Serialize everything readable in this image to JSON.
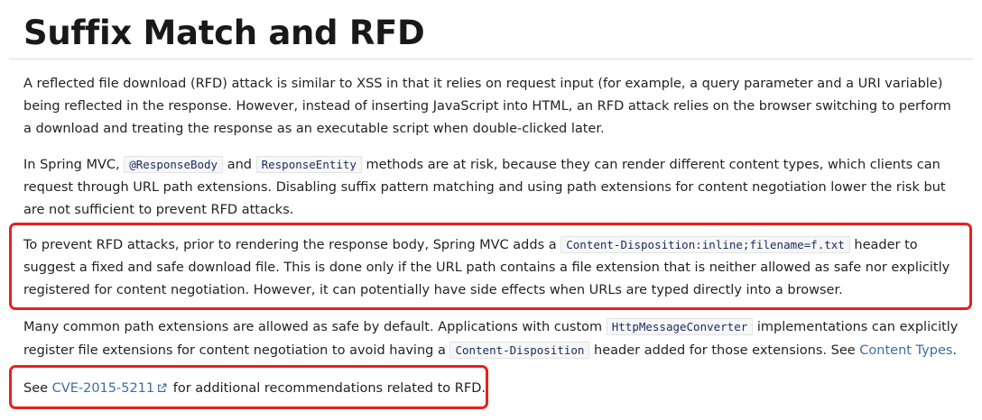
{
  "title": "Suffix Match and RFD",
  "p1": {
    "text": "A reflected file download (RFD) attack is similar to XSS in that it relies on request input (for example, a query parameter and a URI variable) being reflected in the response. However, instead of inserting JavaScript into HTML, an RFD attack relies on the browser switching to perform a download and treating the response as an executable script when double-clicked later."
  },
  "p2": {
    "t1": "In Spring MVC, ",
    "c1": "@ResponseBody",
    "t2": " and ",
    "c2": "ResponseEntity",
    "t3": " methods are at risk, because they can render different content types, which clients can request through URL path extensions. Disabling suffix pattern matching and using path extensions for content negotiation lower the risk but are not sufficient to prevent RFD attacks."
  },
  "p3": {
    "t1": "To prevent RFD attacks, prior to rendering the response body, Spring MVC adds a ",
    "c1": "Content-Disposition:inline;filename=f.txt",
    "t2": " header to suggest a fixed and safe download file. This is done only if the URL path contains a file extension that is neither allowed as safe nor explicitly registered for content negotiation. However, it can potentially have side effects when URLs are typed directly into a browser."
  },
  "p4": {
    "t1": "Many common path extensions are allowed as safe by default. Applications with custom ",
    "c1": "HttpMessageConverter",
    "t2": " implementations can explicitly register file extensions for content negotiation to avoid having a ",
    "c2": "Content-Disposition",
    "t3": " header added for those extensions. See ",
    "link": "Content Types",
    "t4": "."
  },
  "p5": {
    "t1": "See ",
    "link": "CVE-2015-5211",
    "t2": " for additional recommendations related to RFD."
  },
  "icons": {
    "external_link": "external-link-icon"
  },
  "colors": {
    "highlight": "#e8201d",
    "link": "#3a6ea5",
    "code_text": "#1a2b5e",
    "code_bg": "#f7f7f7"
  }
}
